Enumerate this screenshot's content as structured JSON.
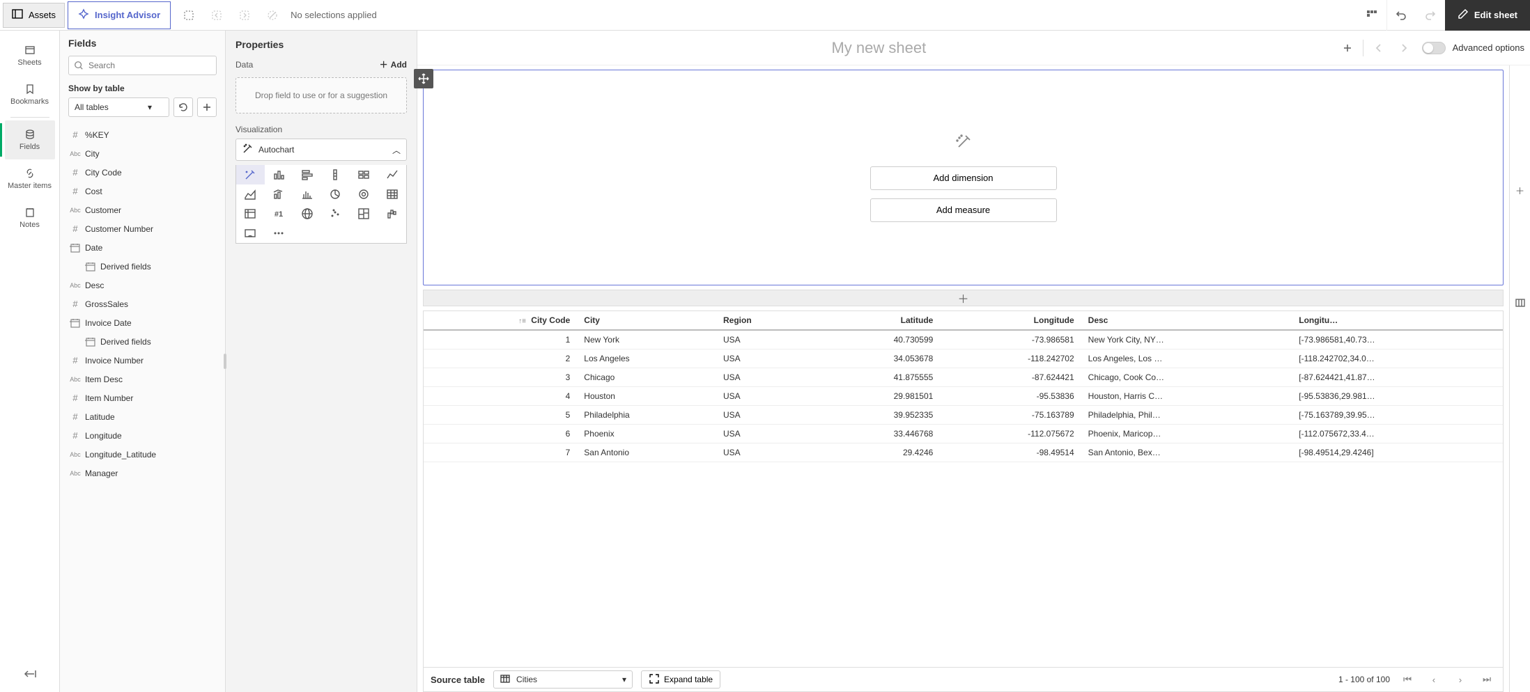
{
  "topbar": {
    "assets_label": "Assets",
    "insight_label": "Insight Advisor",
    "no_selections": "No selections applied",
    "edit_sheet": "Edit sheet"
  },
  "nav": {
    "sheets": "Sheets",
    "bookmarks": "Bookmarks",
    "fields": "Fields",
    "master_items": "Master items",
    "notes": "Notes"
  },
  "fields_panel": {
    "title": "Fields",
    "search_placeholder": "Search",
    "show_by_table": "Show by table",
    "tables_selected": "All tables",
    "items": [
      {
        "type": "hash",
        "label": "%KEY"
      },
      {
        "type": "abc",
        "label": "City"
      },
      {
        "type": "hash",
        "label": "City Code"
      },
      {
        "type": "hash",
        "label": "Cost"
      },
      {
        "type": "abc",
        "label": "Customer"
      },
      {
        "type": "hash",
        "label": "Customer Number"
      },
      {
        "type": "date",
        "label": "Date"
      },
      {
        "type": "date",
        "label": "Derived fields",
        "child": true
      },
      {
        "type": "abc",
        "label": "Desc"
      },
      {
        "type": "hash",
        "label": "GrossSales"
      },
      {
        "type": "date",
        "label": "Invoice Date"
      },
      {
        "type": "date",
        "label": "Derived fields",
        "child": true
      },
      {
        "type": "hash",
        "label": "Invoice Number"
      },
      {
        "type": "abc",
        "label": "Item Desc"
      },
      {
        "type": "hash",
        "label": "Item Number"
      },
      {
        "type": "hash",
        "label": "Latitude"
      },
      {
        "type": "hash",
        "label": "Longitude"
      },
      {
        "type": "abc",
        "label": "Longitude_Latitude"
      },
      {
        "type": "abc",
        "label": "Manager"
      }
    ]
  },
  "props": {
    "title": "Properties",
    "data_label": "Data",
    "add_label": "Add",
    "drop_hint": "Drop field to use or for a suggestion",
    "viz_label": "Visualization",
    "viz_selected": "Autochart"
  },
  "sheet": {
    "title": "My new sheet",
    "advanced_label": "Advanced options",
    "add_dimension": "Add dimension",
    "add_measure": "Add measure"
  },
  "table": {
    "columns": [
      "City Code",
      "City",
      "Region",
      "Latitude",
      "Longitude",
      "Desc",
      "Longitu…"
    ],
    "rows": [
      {
        "code": "1",
        "city": "New York",
        "region": "USA",
        "lat": "40.730599",
        "lon": "-73.986581",
        "desc": "New York City, NY…",
        "ll": "[-73.986581,40.73…"
      },
      {
        "code": "2",
        "city": "Los Angeles",
        "region": "USA",
        "lat": "34.053678",
        "lon": "-118.242702",
        "desc": "Los Angeles, Los …",
        "ll": "[-118.242702,34.0…"
      },
      {
        "code": "3",
        "city": "Chicago",
        "region": "USA",
        "lat": "41.875555",
        "lon": "-87.624421",
        "desc": "Chicago, Cook Co…",
        "ll": "[-87.624421,41.87…"
      },
      {
        "code": "4",
        "city": "Houston",
        "region": "USA",
        "lat": "29.981501",
        "lon": "-95.53836",
        "desc": "Houston, Harris C…",
        "ll": "[-95.53836,29.981…"
      },
      {
        "code": "5",
        "city": "Philadelphia",
        "region": "USA",
        "lat": "39.952335",
        "lon": "-75.163789",
        "desc": "Philadelphia, Phil…",
        "ll": "[-75.163789,39.95…"
      },
      {
        "code": "6",
        "city": "Phoenix",
        "region": "USA",
        "lat": "33.446768",
        "lon": "-112.075672",
        "desc": "Phoenix, Maricop…",
        "ll": "[-112.075672,33.4…"
      },
      {
        "code": "7",
        "city": "San Antonio",
        "region": "USA",
        "lat": "29.4246",
        "lon": "-98.49514",
        "desc": "San Antonio, Bex…",
        "ll": "[-98.49514,29.4246]"
      }
    ],
    "source_label": "Source table",
    "source_value": "Cities",
    "expand_label": "Expand table",
    "page_info": "1 - 100 of 100"
  }
}
